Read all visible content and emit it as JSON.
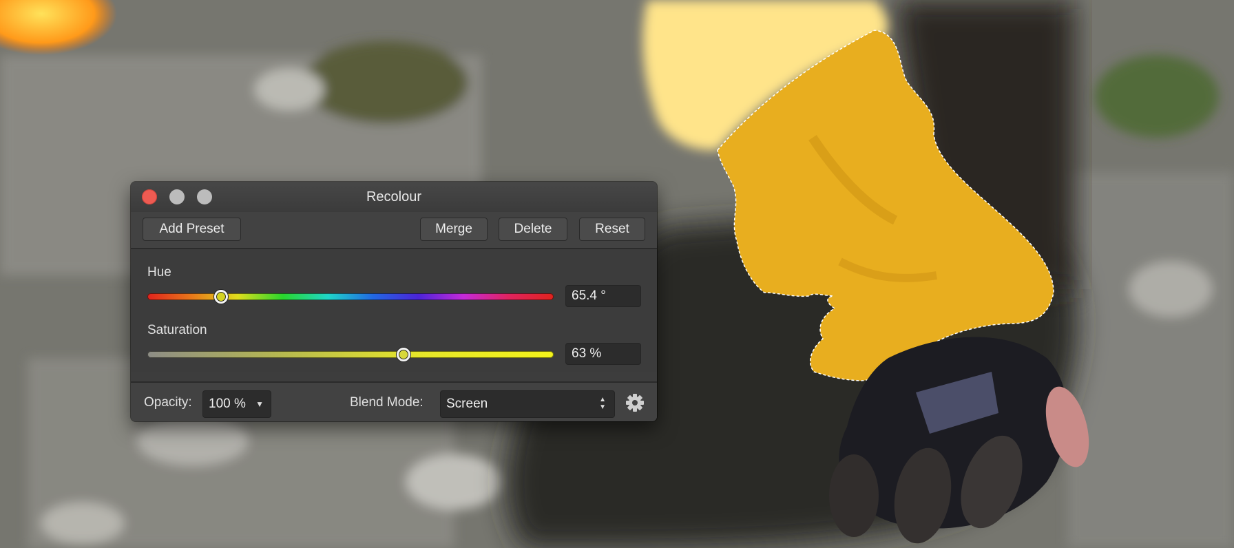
{
  "window": {
    "title": "Recolour"
  },
  "toolbar": {
    "add_preset_label": "Add Preset",
    "merge_label": "Merge",
    "delete_label": "Delete",
    "reset_label": "Reset"
  },
  "hue": {
    "label": "Hue",
    "value": 65.4,
    "display": "65.4 °"
  },
  "saturation": {
    "label": "Saturation",
    "value": 63,
    "display": "63 %"
  },
  "footer": {
    "opacity_label": "Opacity:",
    "opacity_value": "100 %",
    "blend_label": "Blend Mode:",
    "blend_value": "Screen"
  },
  "icons": {
    "close": "close-icon",
    "minimize": "minimize-icon",
    "maximize": "maximize-icon",
    "settings": "gear-icon"
  },
  "colors": {
    "panel": "#3d3d3d",
    "close_button": "#ee5b52",
    "selection_fill": "#e8ae1f"
  }
}
